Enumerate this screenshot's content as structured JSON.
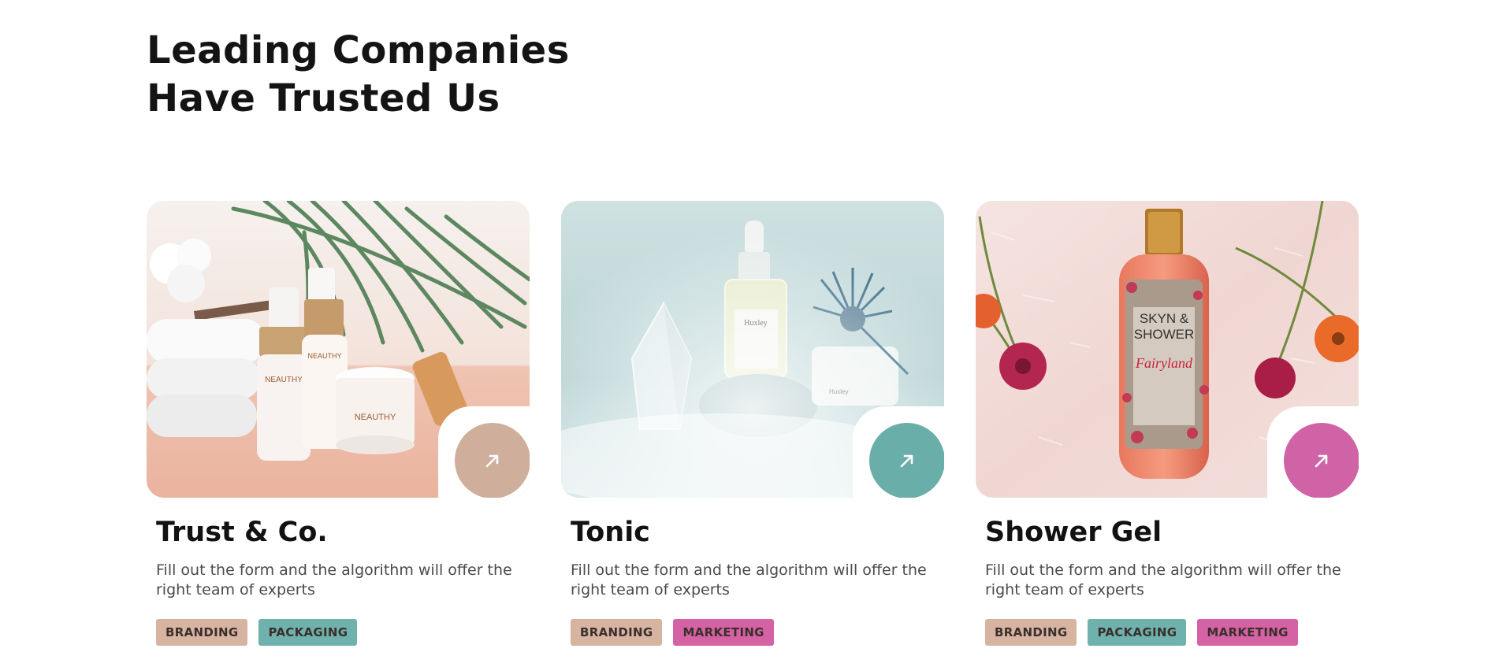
{
  "header": {
    "title_line1": "Leading Companies",
    "title_line2": "Have Trusted Us"
  },
  "colors": {
    "branding": "#d7b4a2",
    "packaging": "#6fb2ad",
    "marketing": "#d462a4",
    "arrow_beige": "#cfae9b",
    "arrow_teal": "#6aaea9",
    "arrow_pink": "#cf63a6"
  },
  "cards": [
    {
      "title": "Trust & Co.",
      "description": "Fill out the form and the algorithm will offer the right team of experts",
      "image": "skincare-bottles-with-towels-and-palm-leaf",
      "product_text": "NEAUTHY",
      "tags": [
        "BRANDING",
        "PACKAGING"
      ]
    },
    {
      "title": "Tonic",
      "description": "Fill out the form and the algorithm will offer the right team of experts",
      "image": "serum-bottle-with-crystals-and-mist",
      "product_text": "Huxley",
      "tags": [
        "BRANDING",
        "MARKETING"
      ]
    },
    {
      "title": "Shower Gel",
      "description": "Fill out the form and the algorithm will offer the right team of experts",
      "image": "shower-gel-bottle-on-fur-with-flowers",
      "product_text": "SKYN & SHOWER",
      "product_subtext": "Fairyland",
      "tags": [
        "BRANDING",
        "PACKAGING",
        "MARKETING"
      ]
    }
  ]
}
